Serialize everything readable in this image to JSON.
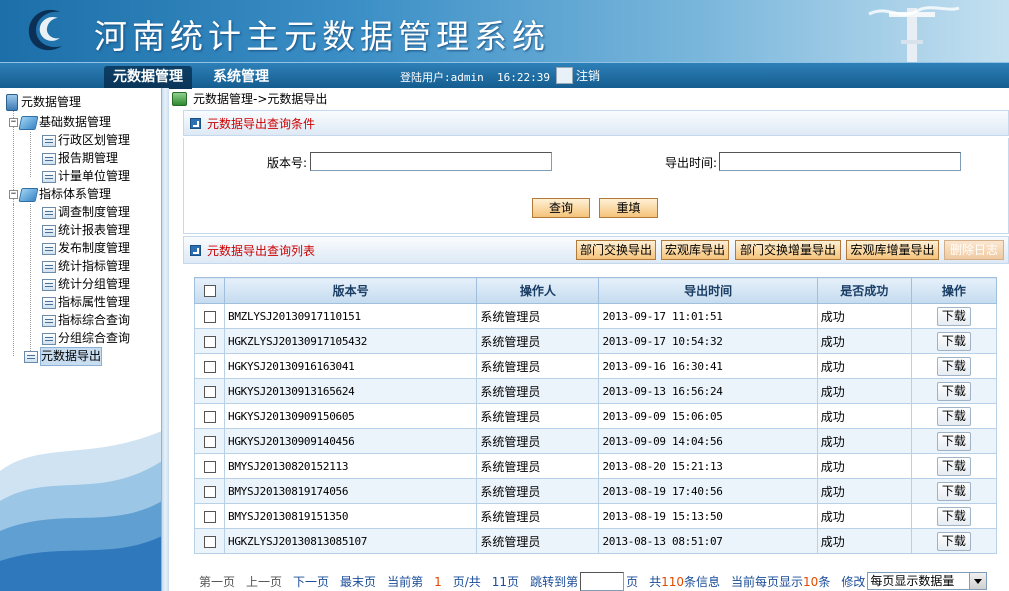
{
  "app": {
    "title": "河南统计主元数据管理系统"
  },
  "nav": {
    "tabs": [
      {
        "label": "元数据管理"
      },
      {
        "label": "系统管理"
      }
    ],
    "user_info": "登陆用户:admin  16:22:39",
    "logout_label": "注销"
  },
  "sidebar": {
    "root": "元数据管理",
    "groups": [
      {
        "label": "基础数据管理",
        "items": [
          "行政区划管理",
          "报告期管理",
          "计量单位管理"
        ]
      },
      {
        "label": "指标体系管理",
        "items": [
          "调查制度管理",
          "统计报表管理",
          "发布制度管理",
          "统计指标管理",
          "统计分组管理",
          "指标属性管理",
          "指标综合查询",
          "分组综合查询"
        ]
      }
    ],
    "selected": "元数据导出"
  },
  "breadcrumb": "元数据管理->元数据导出",
  "query_panel": {
    "title": "元数据导出查询条件",
    "version_label": "版本号:",
    "version_value": "",
    "export_time_label": "导出时间:",
    "export_time_value": "",
    "query_button": "查询",
    "reset_button": "重填"
  },
  "list_panel": {
    "title": "元数据导出查询列表",
    "buttons": [
      "部门交换导出",
      "宏观库导出",
      "部门交换增量导出",
      "宏观库增量导出",
      "删除日志"
    ],
    "disabled_button": "删除日志"
  },
  "table": {
    "headers": [
      "版本号",
      "操作人",
      "导出时间",
      "是否成功",
      "操作"
    ],
    "download_label": "下载",
    "rows": [
      {
        "version": "BMZLYSJ20130917110151",
        "operator": "系统管理员",
        "time": "2013-09-17 11:01:51",
        "success": "成功"
      },
      {
        "version": "HGKZLYSJ20130917105432",
        "operator": "系统管理员",
        "time": "2013-09-17 10:54:32",
        "success": "成功"
      },
      {
        "version": "HGKYSJ20130916163041",
        "operator": "系统管理员",
        "time": "2013-09-16 16:30:41",
        "success": "成功"
      },
      {
        "version": "HGKYSJ20130913165624",
        "operator": "系统管理员",
        "time": "2013-09-13 16:56:24",
        "success": "成功"
      },
      {
        "version": "HGKYSJ20130909150605",
        "operator": "系统管理员",
        "time": "2013-09-09 15:06:05",
        "success": "成功"
      },
      {
        "version": "HGKYSJ20130909140456",
        "operator": "系统管理员",
        "time": "2013-09-09 14:04:56",
        "success": "成功"
      },
      {
        "version": "BMYSJ20130820152113",
        "operator": "系统管理员",
        "time": "2013-08-20 15:21:13",
        "success": "成功"
      },
      {
        "version": "BMYSJ20130819174056",
        "operator": "系统管理员",
        "time": "2013-08-19 17:40:56",
        "success": "成功"
      },
      {
        "version": "BMYSJ20130819151350",
        "operator": "系统管理员",
        "time": "2013-08-19 15:13:50",
        "success": "成功"
      },
      {
        "version": "HGKZLYSJ20130813085107",
        "operator": "系统管理员",
        "time": "2013-08-13 08:51:07",
        "success": "成功"
      }
    ]
  },
  "pager": {
    "first": "第一页",
    "prev": "上一页",
    "next": "下一页",
    "last": "최末页",
    "current_prefix": "当前第",
    "current_page": "1",
    "current_mid": "页/共",
    "total_pages": "11",
    "current_suffix": "页",
    "goto_prefix": "跳转到第",
    "goto_value": "",
    "goto_suffix": "页",
    "total_prefix": "共",
    "total_count": "110",
    "total_suffix": "条信息",
    "per_page_prefix": "当前每页显示",
    "per_page": "10",
    "per_page_suffix": "条",
    "modify_label": "修改",
    "per_page_select": "每页显示数据量"
  },
  "colors": {
    "header_blue": "#1c6fa8",
    "title_red": "#cc0000",
    "pager_red": "#e04a00",
    "link_blue": "#1a4c99"
  }
}
